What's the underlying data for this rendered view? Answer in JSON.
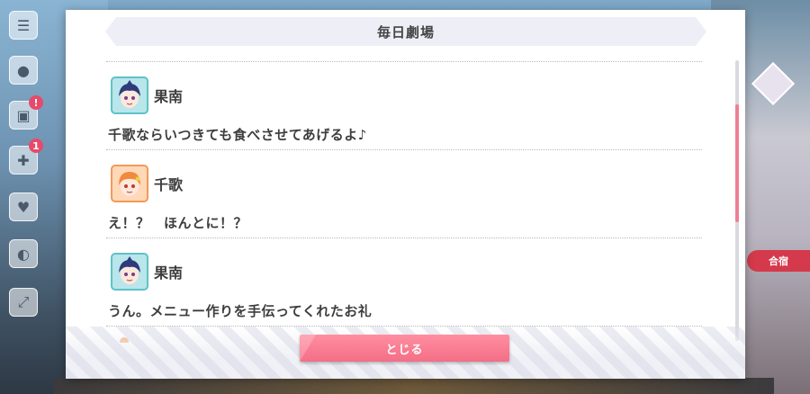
{
  "dialog": {
    "title": "毎日劇場",
    "close_label": "とじる"
  },
  "entries": [
    {
      "speaker": "果南",
      "avatar_icon": "kanan-portrait-icon",
      "text": "千歌ならいつきても食べさせてあげるよ♪"
    },
    {
      "speaker": "千歌",
      "avatar_icon": "chika-portrait-icon",
      "text": "え！？　ほんとに！？"
    },
    {
      "speaker": "果南",
      "avatar_icon": "kanan-portrait-icon",
      "text": "うん。メニュー作りを手伝ってくれたお礼"
    }
  ],
  "scroll": {
    "position_fraction": 0.27,
    "visible_fraction": 0.42
  },
  "side_menu": {
    "icons": [
      "menu-icon",
      "chat-icon",
      "bag-icon",
      "gift-icon",
      "heart-icon",
      "character-icon",
      "expand-icon"
    ],
    "badges": [
      "!",
      "1"
    ]
  },
  "right_hud": {
    "label": "合宿"
  },
  "colors": {
    "accent": "#f46e86",
    "kanan": "#5ec2c9",
    "chika": "#f39a5a"
  }
}
